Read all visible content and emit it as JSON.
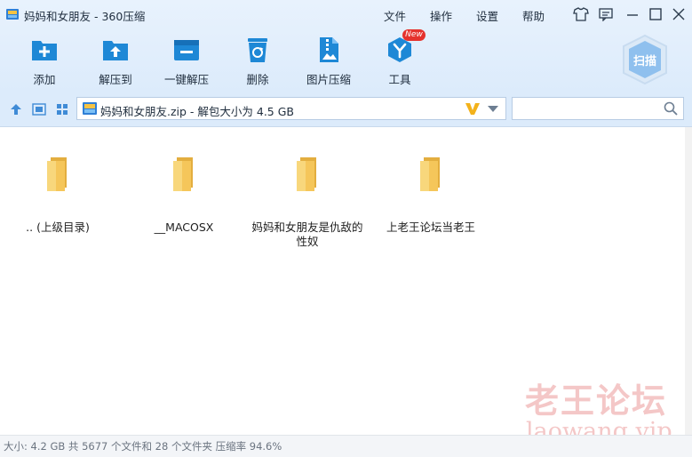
{
  "window": {
    "title": "妈妈和女朋友 - 360压缩",
    "menu": [
      "文件",
      "操作",
      "设置",
      "帮助"
    ]
  },
  "toolbar": {
    "items": [
      {
        "label": "添加",
        "icon": "add-icon"
      },
      {
        "label": "解压到",
        "icon": "extract-to-icon"
      },
      {
        "label": "一键解压",
        "icon": "one-click-extract-icon"
      },
      {
        "label": "删除",
        "icon": "recycle-bin-icon"
      },
      {
        "label": "图片压缩",
        "icon": "image-compress-icon"
      },
      {
        "label": "工具",
        "icon": "tools-icon"
      }
    ],
    "new_badge": "New",
    "scan_label": "扫描"
  },
  "address": {
    "path": "妈妈和女朋友.zip - 解包大小为 4.5 GB"
  },
  "search": {
    "value": "",
    "placeholder": ""
  },
  "files": [
    {
      "name": ".. (上级目录)"
    },
    {
      "name": "__MACOSX"
    },
    {
      "name": "妈妈和女朋友是仇敌的性奴"
    },
    {
      "name": "上老王论坛当老王"
    }
  ],
  "status": {
    "text": "大小: 4.2 GB 共 5677 个文件和 28 个文件夹 压缩率 94.6%"
  },
  "watermark": {
    "line1": "老王论坛",
    "line2": "laowang.vip"
  },
  "colors": {
    "accent": "#1e88d6",
    "folder": "#f5c65a",
    "new_badge": "#e5322d"
  }
}
